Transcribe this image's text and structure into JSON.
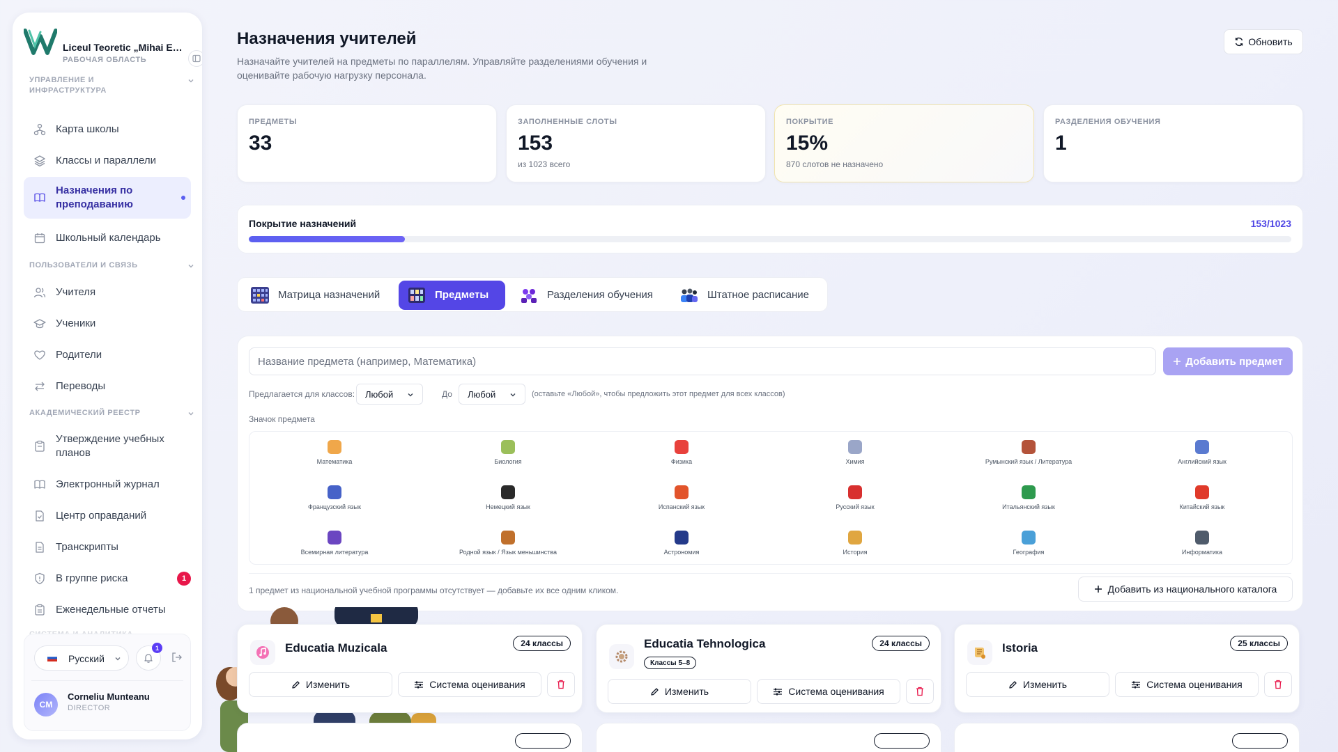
{
  "sidebar": {
    "school_name": "Liceul Teoretic „Mihai Emi...",
    "workspace": "РАБОЧАЯ ОБЛАСТЬ",
    "sections": {
      "management": "УПРАВЛЕНИЕ И ИНФРАСТРУКТУРА",
      "users": "ПОЛЬЗОВАТЕЛИ И СВЯЗЬ",
      "academic": "АКАДЕМИЧЕСКИЙ РЕЕСТР",
      "system": "СИСТЕМА И АНАЛИТИКА"
    },
    "items": [
      {
        "label": "Карта школы",
        "icon": "map-icon"
      },
      {
        "label": "Классы и параллели",
        "icon": "layers-icon"
      },
      {
        "label": "Назначения по преподаванию",
        "icon": "book-open-icon",
        "active": true
      },
      {
        "label": "Школьный календарь",
        "icon": "calendar-icon"
      },
      {
        "label": "Учителя",
        "icon": "users-icon"
      },
      {
        "label": "Ученики",
        "icon": "graduation-cap-icon"
      },
      {
        "label": "Родители",
        "icon": "heart-icon"
      },
      {
        "label": "Переводы",
        "icon": "transfer-icon"
      },
      {
        "label": "Утверждение учебных планов",
        "icon": "clipboard-icon"
      },
      {
        "label": "Электронный журнал",
        "icon": "book-icon"
      },
      {
        "label": "Центр оправданий",
        "icon": "file-check-icon"
      },
      {
        "label": "Транскрипты",
        "icon": "file-text-icon"
      },
      {
        "label": "В группе риска",
        "icon": "shield-icon",
        "badge": "1"
      },
      {
        "label": "Еженедельные отчеты",
        "icon": "clipboard-list-icon"
      }
    ],
    "footer": {
      "language": "Русский",
      "notifications": "1",
      "user_initials": "CM",
      "user_name": "Corneliu Munteanu",
      "user_role": "DIRECTOR"
    }
  },
  "header": {
    "title": "Назначения учителей",
    "description": "Назначайте учителей на предметы по параллелям. Управляйте разделениями обучения и оценивайте рабочую нагрузку персонала.",
    "refresh_label": "Обновить"
  },
  "stats": [
    {
      "label": "ПРЕДМЕТЫ",
      "value": "33",
      "sub": ""
    },
    {
      "label": "ЗАПОЛНЕННЫЕ СЛОТЫ",
      "value": "153",
      "sub": "из 1023 всего"
    },
    {
      "label": "ПОКРЫТИЕ",
      "value": "15%",
      "sub": "870 слотов не назначено"
    },
    {
      "label": "РАЗДЕЛЕНИЯ ОБУЧЕНИЯ",
      "value": "1",
      "sub": ""
    }
  ],
  "coverage": {
    "title": "Покрытие назначений",
    "count": "153/1023",
    "filled": 153,
    "total": 1023
  },
  "tabs": [
    {
      "label": "Матрица назначений",
      "icon": "matrix-icon"
    },
    {
      "label": "Предметы",
      "icon": "subjects-icon",
      "active": true
    },
    {
      "label": "Разделения обучения",
      "icon": "split-icon"
    },
    {
      "label": "Штатное расписание",
      "icon": "staff-icon"
    }
  ],
  "subjects_form": {
    "name_placeholder": "Название предмета (например, Математика)",
    "add_label": "Добавить предмет",
    "offered_label": "Предлагается для классов:",
    "from_value": "Любой",
    "to_label": "До",
    "to_value": "Любой",
    "hint": "(оставьте «Любой», чтобы предложить этот предмет для всех классов)",
    "icon_label": "Значок предмета",
    "icons": [
      {
        "label": "Математика",
        "color": "#f0a74a"
      },
      {
        "label": "Биология",
        "color": "#9bbf5a"
      },
      {
        "label": "Физика",
        "color": "#e8413c"
      },
      {
        "label": "Химия",
        "color": "#9aa6c8"
      },
      {
        "label": "Румынский язык / Литература",
        "color": "#b4533a"
      },
      {
        "label": "Английский язык",
        "color": "#5a7ad0"
      },
      {
        "label": "Французский язык",
        "color": "#4662c8"
      },
      {
        "label": "Немецкий язык",
        "color": "#2a2a2a"
      },
      {
        "label": "Испанский язык",
        "color": "#e2542b"
      },
      {
        "label": "Русский язык",
        "color": "#d8302f"
      },
      {
        "label": "Итальянский язык",
        "color": "#2e9a4e"
      },
      {
        "label": "Китайский язык",
        "color": "#e03a2a"
      },
      {
        "label": "Всемирная литература",
        "color": "#6b46c1"
      },
      {
        "label": "Родной язык / Язык меньшинства",
        "color": "#c0702c"
      },
      {
        "label": "Астрономия",
        "color": "#243a8a"
      },
      {
        "label": "История",
        "color": "#e0a640"
      },
      {
        "label": "География",
        "color": "#4aa0d8"
      },
      {
        "label": "Информатика",
        "color": "#4f5b6b"
      }
    ],
    "missing_text": "1 предмет из национальной учебной программы отсутствует — добавьте их все одним кликом.",
    "catalog_label": "Добавить из национального каталога"
  },
  "subject_cards": [
    {
      "title": "Educatia Muzicala",
      "count": "24 классы",
      "range": "",
      "icon": "music-icon",
      "edit": "Изменить",
      "grading": "Система оценивания"
    },
    {
      "title": "Educatia Tehnologica",
      "count": "24 классы",
      "range": "Классы 5–8",
      "icon": "gear-icon",
      "edit": "Изменить",
      "grading": "Система оценивания"
    },
    {
      "title": "Istoria",
      "count": "25 классы",
      "range": "",
      "icon": "history-icon",
      "edit": "Изменить",
      "grading": "Система оценивания"
    }
  ],
  "colors": {
    "accent": "#5446e6",
    "danger": "#e8174a"
  }
}
